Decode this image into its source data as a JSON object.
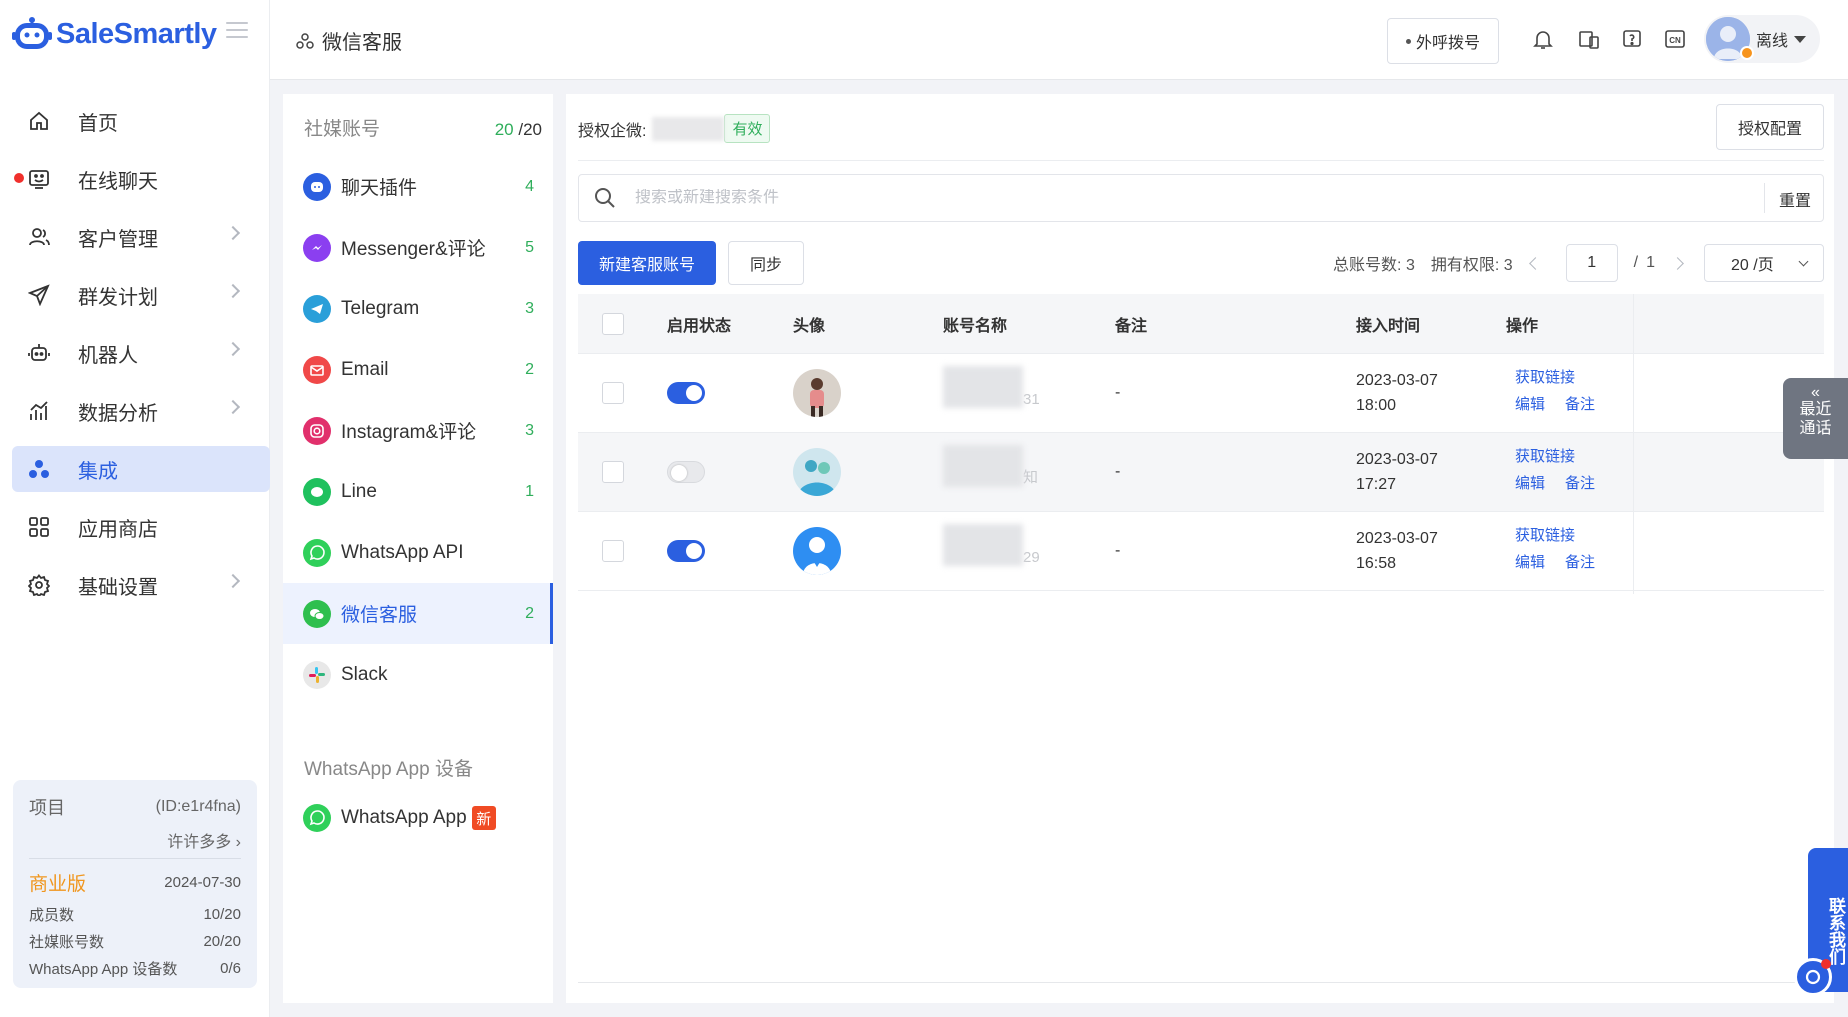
{
  "brand": {
    "name": "SaleSmartly",
    "accent": "#2b5fe0"
  },
  "sidebar": {
    "items": [
      {
        "label": "首页",
        "icon": "home-icon",
        "chevron": false
      },
      {
        "label": "在线聊天",
        "icon": "chat-icon",
        "chevron": false,
        "unread_dot": true
      },
      {
        "label": "客户管理",
        "icon": "users-icon",
        "chevron": true
      },
      {
        "label": "群发计划",
        "icon": "send-icon",
        "chevron": true
      },
      {
        "label": "机器人",
        "icon": "robot-icon",
        "chevron": true
      },
      {
        "label": "数据分析",
        "icon": "chart-icon",
        "chevron": true
      },
      {
        "label": "集成",
        "icon": "integration-icon",
        "chevron": false,
        "active": true
      },
      {
        "label": "应用商店",
        "icon": "apps-icon",
        "chevron": false
      },
      {
        "label": "基础设置",
        "icon": "settings-icon",
        "chevron": true
      }
    ],
    "project": {
      "title": "项目",
      "id": "(ID:e1r4fna)",
      "owner": "许许多多",
      "plan": "商业版",
      "expiry": "2024-07-30",
      "stats": [
        {
          "label": "成员数",
          "value": "10/20"
        },
        {
          "label": "社媒账号数",
          "value": "20/20"
        },
        {
          "label": "WhatsApp App 设备数",
          "value": "0/6"
        }
      ]
    }
  },
  "header": {
    "title": "微信客服",
    "call_button": "外呼拨号",
    "user_status": "离线",
    "lang_badge": "CN"
  },
  "channels": {
    "title": "社媒账号",
    "count_used": "20",
    "count_total": "/20",
    "items": [
      {
        "label": "聊天插件",
        "count": "4",
        "color": "#2b5fe0",
        "icon": "chat-plugin-icon"
      },
      {
        "label": "Messenger&评论",
        "count": "5",
        "color": "#8b3ff0",
        "icon": "messenger-icon"
      },
      {
        "label": "Telegram",
        "count": "3",
        "color": "#2a9fd9",
        "icon": "telegram-icon"
      },
      {
        "label": "Email",
        "count": "2",
        "color": "#f04848",
        "icon": "email-icon"
      },
      {
        "label": "Instagram&评论",
        "count": "3",
        "color": "#e1306c",
        "icon": "instagram-icon"
      },
      {
        "label": "Line",
        "count": "1",
        "color": "#1fc15e",
        "icon": "line-icon"
      },
      {
        "label": "WhatsApp API",
        "count": "",
        "color": "#2fd05a",
        "icon": "whatsapp-api-icon"
      },
      {
        "label": "微信客服",
        "count": "2",
        "color": "#2fbf4e",
        "icon": "wechat-icon",
        "active": true
      },
      {
        "label": "Slack",
        "count": "",
        "color": "#e8e8e8",
        "icon": "slack-icon"
      }
    ],
    "device_title": "WhatsApp App 设备",
    "device_item": "WhatsApp App",
    "new_badge": "新"
  },
  "main": {
    "auth_label": "授权企微:",
    "auth_status": "有效",
    "auth_button": "授权配置",
    "search_placeholder": "搜索或新建搜索条件",
    "reset": "重置",
    "new_button": "新建客服账号",
    "sync_button": "同步",
    "total_label": "总账号数: 3",
    "perm_label": "拥有权限: 3",
    "page_current": "1",
    "page_sep": "/",
    "page_total": "1",
    "page_size": "20 /页",
    "columns": [
      "启用状态",
      "头像",
      "账号名称",
      "备注",
      "接入时间",
      "操作"
    ],
    "rows": [
      {
        "enabled": true,
        "avatar": "avatar-woman-icon",
        "name_suffix": "31",
        "note": "-",
        "date": "2023-03-07",
        "time": "18:00"
      },
      {
        "enabled": false,
        "avatar": "avatar-group-icon",
        "name_suffix": "知",
        "note": "-",
        "date": "2023-03-07",
        "time": "17:27"
      },
      {
        "enabled": true,
        "avatar": "avatar-default-icon",
        "name_suffix": "29",
        "note": "-",
        "date": "2023-03-07",
        "time": "16:58"
      }
    ],
    "actions": {
      "get_link": "获取链接",
      "edit": "编辑",
      "note": "备注"
    }
  },
  "floating": {
    "recent_calls": [
      "最近",
      "通话"
    ],
    "contact_us": "联系我们"
  }
}
